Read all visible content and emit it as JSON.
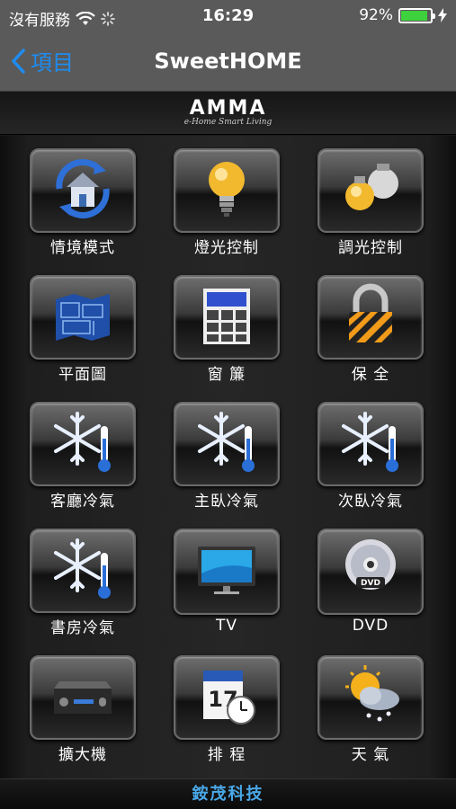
{
  "status_bar": {
    "carrier": "沒有服務",
    "time": "16:29",
    "battery": "92%",
    "battery_level": 0.92,
    "battery_color": "#3dd13d"
  },
  "nav": {
    "back_label": "項目",
    "title": "SweetHOME",
    "accent_color": "#1e8cf0"
  },
  "brand": {
    "logo": "AMMA",
    "tagline": "e-Home Smart Living"
  },
  "tiles": [
    {
      "label": "情境模式",
      "icon": "scene-mode-icon"
    },
    {
      "label": "燈光控制",
      "icon": "light-bulb-icon"
    },
    {
      "label": "調光控制",
      "icon": "dimmer-bulbs-icon"
    },
    {
      "label": "平面圖",
      "icon": "floor-plan-icon"
    },
    {
      "label": "窗 簾",
      "icon": "window-curtain-icon"
    },
    {
      "label": "保 全",
      "icon": "security-lock-icon"
    },
    {
      "label": "客廳冷氣",
      "icon": "snowflake-thermometer-icon"
    },
    {
      "label": "主臥冷氣",
      "icon": "snowflake-thermometer-icon"
    },
    {
      "label": "次臥冷氣",
      "icon": "snowflake-thermometer-icon"
    },
    {
      "label": "書房冷氣",
      "icon": "snowflake-thermometer-icon"
    },
    {
      "label": "TV",
      "icon": "tv-icon"
    },
    {
      "label": "DVD",
      "icon": "dvd-disc-icon"
    },
    {
      "label": "擴大機",
      "icon": "amplifier-icon"
    },
    {
      "label": "排 程",
      "icon": "calendar-clock-icon"
    },
    {
      "label": "天 氣",
      "icon": "weather-icon"
    }
  ],
  "footer": {
    "text": "銨茂科技"
  }
}
